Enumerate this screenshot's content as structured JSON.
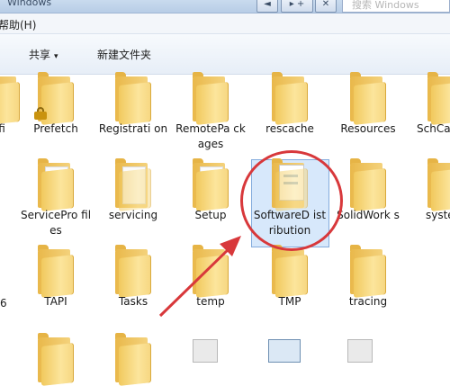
{
  "window": {
    "title": "Windows",
    "search_placeholder": "搜索 Windows",
    "buttons": [
      "◄",
      "▸ +",
      "✕"
    ]
  },
  "menubar": {
    "help": "帮助(H)"
  },
  "toolbar": {
    "share": "共享",
    "share_caret": "▾",
    "new_folder": "新建文件夹"
  },
  "folders": [
    {
      "label": "fi",
      "locked": false
    },
    {
      "label": "Prefetch",
      "locked": true
    },
    {
      "label": "Registrati on",
      "locked": false
    },
    {
      "label": "RemotePa ckages",
      "locked": false
    },
    {
      "label": "rescache",
      "locked": false
    },
    {
      "label": "Resources",
      "locked": false
    },
    {
      "label": "SchCa",
      "locked": false
    },
    {
      "label": "ServicePro files",
      "locked": false
    },
    {
      "label": "servicing",
      "locked": false
    },
    {
      "label": "Setup",
      "locked": false
    },
    {
      "label": "SoftwareD istribution",
      "locked": false,
      "selected": true
    },
    {
      "label": "SolidWork s",
      "locked": false
    },
    {
      "label": "syste",
      "locked": false
    },
    {
      "label": "6",
      "locked": false
    },
    {
      "label": "TAPI",
      "locked": false
    },
    {
      "label": "Tasks",
      "locked": false
    },
    {
      "label": "temp",
      "locked": false
    },
    {
      "label": "TMP",
      "locked": false
    },
    {
      "label": "tracing",
      "locked": false
    }
  ],
  "colors": {
    "highlight": "#d7e8fb",
    "annotation": "#d8383b"
  }
}
